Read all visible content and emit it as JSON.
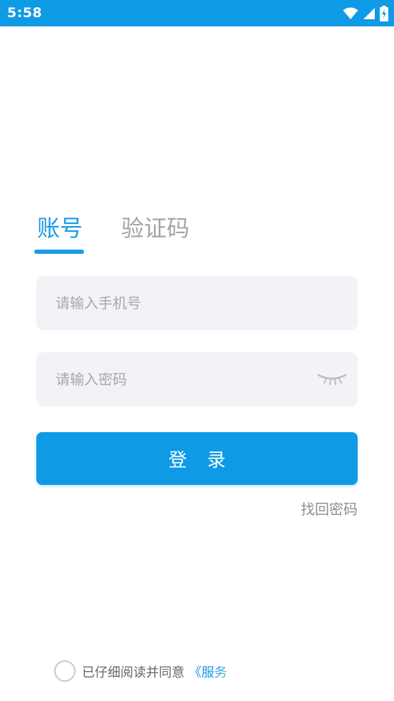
{
  "status_bar": {
    "time": "5:58",
    "background_color": "#0f9ae6",
    "icons": [
      "wifi-icon",
      "signal-icon",
      "battery-charging-icon"
    ]
  },
  "tabs": [
    {
      "label": "账号",
      "active": true
    },
    {
      "label": "验证码",
      "active": false
    }
  ],
  "form": {
    "phone_placeholder": "请输入手机号",
    "phone_value": "",
    "password_placeholder": "请输入密码",
    "password_value": "",
    "password_toggle_icon": "eye-closed-icon"
  },
  "login_button": {
    "label": "登 录",
    "color": "#0f9ae6"
  },
  "forgot_password": "找回密码",
  "agreement": {
    "checked": false,
    "text": "已仔细阅读并同意",
    "link": "《服务"
  },
  "colors": {
    "accent": "#1a9be6",
    "input_background": "#f2f3f6",
    "inactive_tab": "#a4a4a4"
  }
}
